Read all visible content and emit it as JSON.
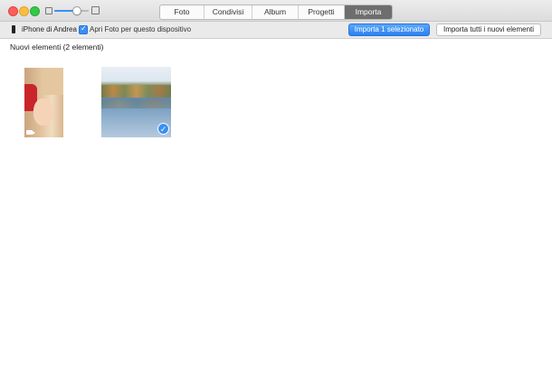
{
  "window": {
    "tabs": [
      {
        "label": "Foto",
        "active": false
      },
      {
        "label": "Condivisi",
        "active": false
      },
      {
        "label": "Album",
        "active": false
      },
      {
        "label": "Progetti",
        "active": false
      },
      {
        "label": "Importa",
        "active": true
      }
    ],
    "zoom_level": 0.65
  },
  "toolbar": {
    "device_label": "iPhone di Andrea",
    "open_photos_label": "Apri Foto per questo dispositivo",
    "open_photos_checked": true,
    "import_selected_label": "Importa 1 selezionato",
    "import_all_label": "Importa tutti i nuovi elementi"
  },
  "content": {
    "section_title": "Nuovi elementi (2 elementi)",
    "items": [
      {
        "kind": "video",
        "selected": false
      },
      {
        "kind": "photo",
        "selected": true
      }
    ]
  },
  "colors": {
    "accent": "#3a8ff5",
    "active_tab": "#6e6e6e"
  },
  "icons": {
    "selected": "checkmark-icon",
    "device": "iphone-icon",
    "video": "video-camera-icon"
  }
}
